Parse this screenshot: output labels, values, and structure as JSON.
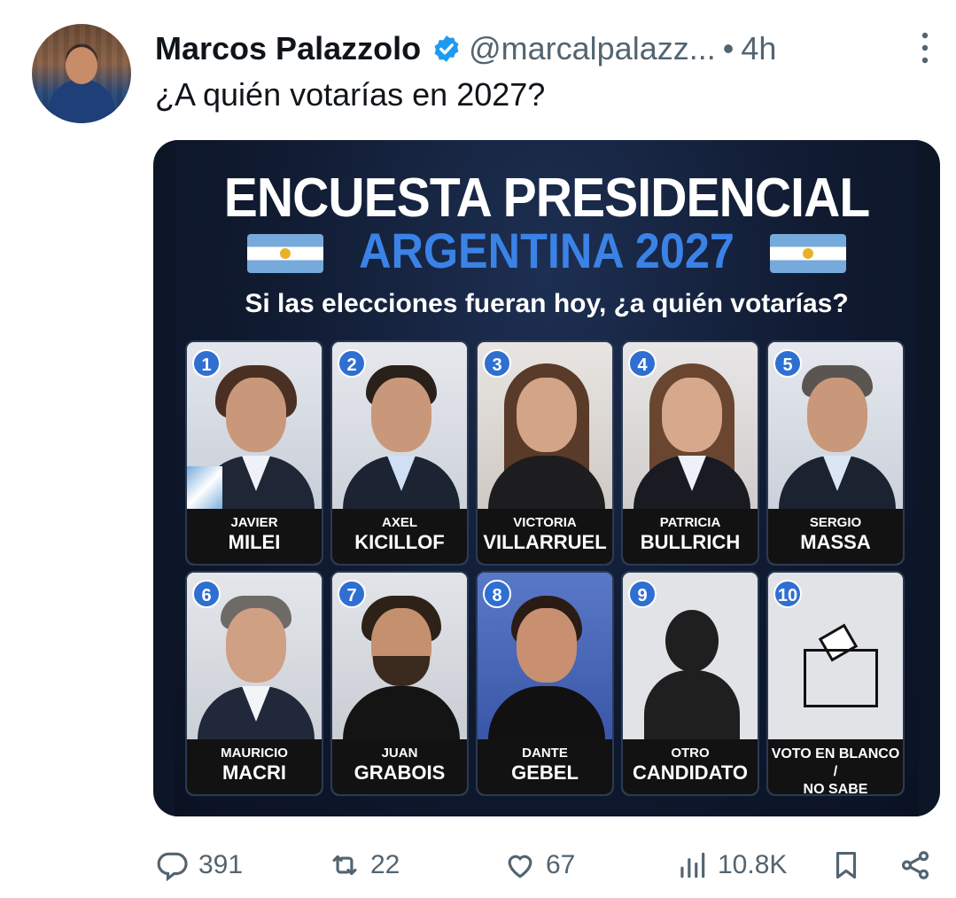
{
  "author": {
    "name": "Marcos Palazzolo",
    "handle": "@marcalpalazz...",
    "separator": "•",
    "time": "4h"
  },
  "tweet": {
    "text": "¿A quién votarías en 2027?"
  },
  "poster": {
    "title": "ENCUESTA PRESIDENCIAL",
    "subtitle": "ARGENTINA 2027",
    "question": "Si las elecciones fueran hoy, ¿a quién votarías?",
    "candidates": [
      {
        "num": "1",
        "first": "JAVIER",
        "last": "MILEI"
      },
      {
        "num": "2",
        "first": "AXEL",
        "last": "KICILLOF"
      },
      {
        "num": "3",
        "first": "VICTORIA",
        "last": "VILLARRUEL"
      },
      {
        "num": "4",
        "first": "PATRICIA",
        "last": "BULLRICH"
      },
      {
        "num": "5",
        "first": "SERGIO",
        "last": "MASSA"
      },
      {
        "num": "6",
        "first": "MAURICIO",
        "last": "MACRI"
      },
      {
        "num": "7",
        "first": "JUAN",
        "last": "GRABOIS"
      },
      {
        "num": "8",
        "first": "DANTE",
        "last": "GEBEL"
      },
      {
        "num": "9",
        "first": "OTRO",
        "last": "CANDIDATO"
      },
      {
        "num": "10",
        "first": "VOTO EN BLANCO /",
        "last": "NO SABE"
      }
    ]
  },
  "actions": {
    "replies": "391",
    "reposts": "22",
    "likes": "67",
    "views": "10.8K"
  },
  "colors": {
    "verified": "#1d9bf0",
    "muted": "#536471",
    "poster_blue": "#3b82e6"
  }
}
